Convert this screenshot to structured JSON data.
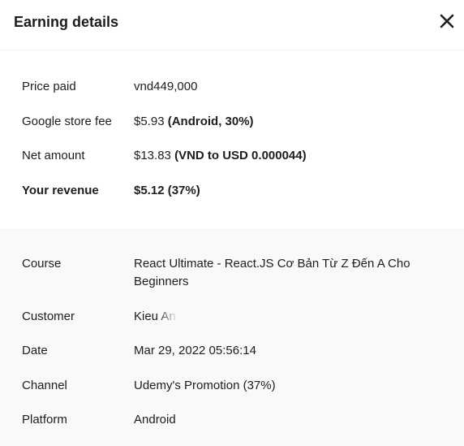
{
  "dialog": {
    "title": "Earning details"
  },
  "earnings": {
    "price_paid": {
      "label": "Price paid",
      "value": "vnd449,000"
    },
    "store_fee": {
      "label": "Google store fee",
      "value": "$5.93",
      "note": "(Android, 30%)"
    },
    "net_amount": {
      "label": "Net amount",
      "value": "$13.83",
      "note": "(VND to USD 0.000044)"
    },
    "revenue": {
      "label": "Your revenue",
      "value": "$5.12 (37%)"
    }
  },
  "details": {
    "course": {
      "label": "Course",
      "value": "React Ultimate - React.JS Cơ Bản Từ Z Đến A Cho Beginners"
    },
    "customer": {
      "label": "Customer",
      "value": "Kieu An"
    },
    "date": {
      "label": "Date",
      "value": "Mar 29, 2022 05:56:14"
    },
    "channel": {
      "label": "Channel",
      "value": "Udemy's Promotion (37%)"
    },
    "platform": {
      "label": "Platform",
      "value": "Android"
    }
  },
  "icons": {
    "close": "close-icon"
  }
}
